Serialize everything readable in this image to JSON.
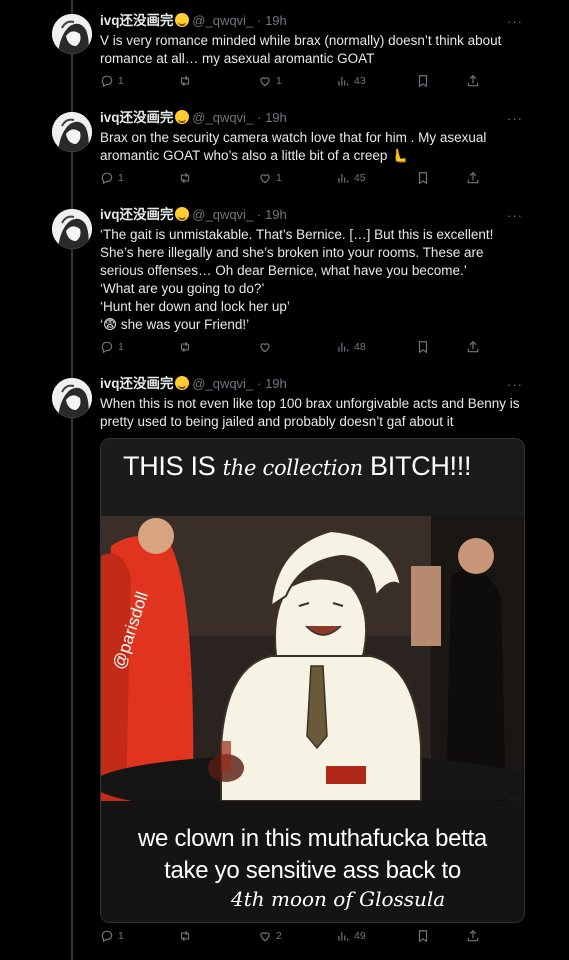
{
  "author": {
    "display_name": "ivq还没画完",
    "handle": "@_qwqvi_",
    "separator": "·",
    "time": "19h",
    "more_label": "···"
  },
  "tweets": [
    {
      "lines": [
        "V is very romance minded while brax (normally) doesn’t think about",
        "romance at all… my asexual aromantic GOAT"
      ],
      "replies": "1",
      "reposts": "",
      "likes": "1",
      "views": "43"
    },
    {
      "lines": [
        "Brax on the security camera watch love that for him . My asexual",
        "aromantic GOAT who’s also a little bit of a creep 🫷"
      ],
      "replies": "1",
      "reposts": "",
      "likes": "1",
      "views": "45"
    },
    {
      "lines": [
        "‘The gait is unmistakable. That’s Bernice. […] But this is excellent!",
        "She’s here illegally and she’s broken into your rooms. These are",
        "serious offenses… Oh dear Bernice, what have you become.’",
        "‘What are you going to do?’",
        "‘Hunt her down and lock her up’",
        "‘😨 she was your Friend!’"
      ],
      "replies": "1",
      "reposts": "",
      "likes": "",
      "views": "48"
    },
    {
      "lines": [
        "When this is not even like top 100 brax unforgivable acts and Benny is",
        "pretty used to being jailed and probably doesn’t gaf about it"
      ],
      "replies": "1",
      "reposts": "",
      "likes": "2",
      "views": "49"
    }
  ],
  "meme": {
    "top_caps": "THIS IS",
    "top_script": "the collection",
    "top_end": "BITCH!!!",
    "watermark": "@parisdoll",
    "bottom_line1": "we clown in this muthafucka betta",
    "bottom_line2": "take yo sensitive ass back to",
    "bottom_line3": "4th moon of Glossula"
  },
  "colors": {
    "background": "#000000",
    "text": "#e7e9ea",
    "muted": "#71767b",
    "thread": "#333639"
  },
  "icons": [
    "reply-icon",
    "repost-icon",
    "like-icon",
    "views-icon",
    "bookmark-icon",
    "share-icon",
    "more-icon"
  ]
}
